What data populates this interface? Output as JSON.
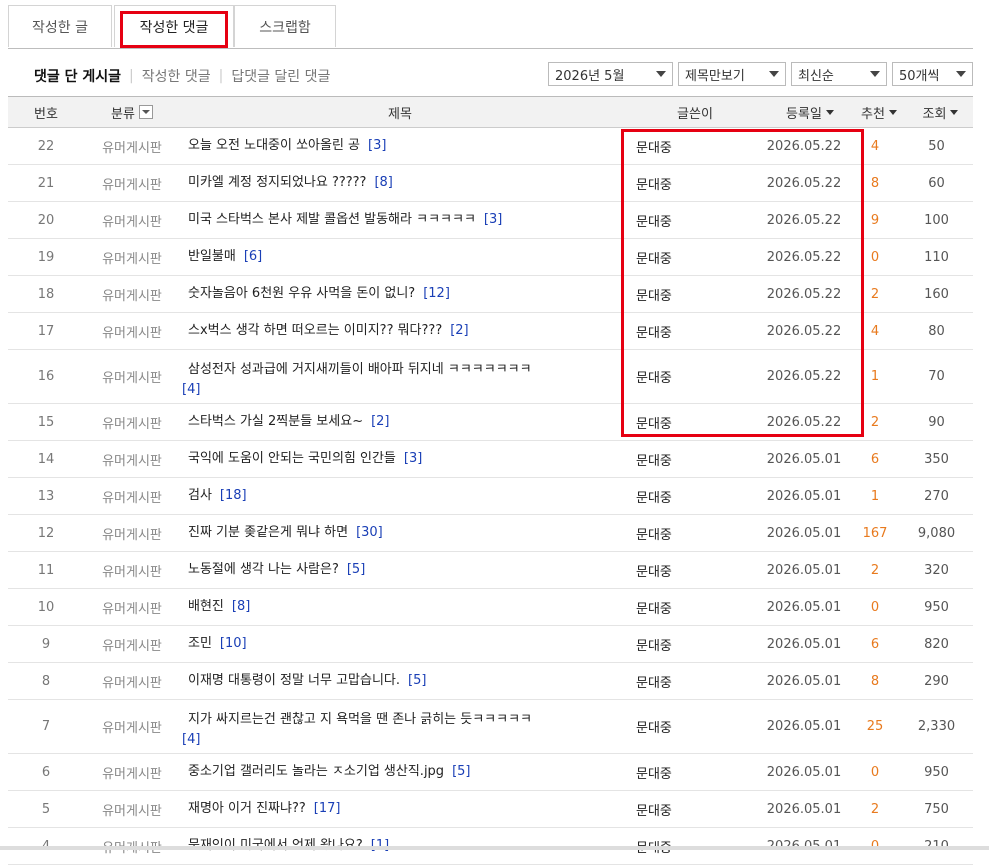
{
  "tabs": [
    {
      "label": "작성한 글",
      "active": false
    },
    {
      "label": "작성한 댓글",
      "active": true
    },
    {
      "label": "스크랩함",
      "active": false
    }
  ],
  "subnav": [
    {
      "label": "댓글 단 게시글",
      "active": true
    },
    {
      "label": "작성한 댓글",
      "active": false
    },
    {
      "label": "답댓글 달린 댓글",
      "active": false
    }
  ],
  "filters": {
    "month": "2026년 5월",
    "view_mode": "제목만보기",
    "sort": "최신순",
    "per_page": "50개씩"
  },
  "columns": {
    "no": "번호",
    "category": "분류",
    "title": "제목",
    "author": "글쓴이",
    "date": "등록일",
    "recommend": "추천",
    "views": "조회"
  },
  "rows": [
    {
      "no": "22",
      "category": "유머게시판",
      "title": "오늘 오전 노대중이 쏘아올린 공",
      "comments": "[3]",
      "author": "문대중",
      "date": "2026.05.22",
      "recommend": "4",
      "views": "50"
    },
    {
      "no": "21",
      "category": "유머게시판",
      "title": "미카엘 계정 정지되었나요 ?????",
      "comments": "[8]",
      "author": "문대중",
      "date": "2026.05.22",
      "recommend": "8",
      "views": "60"
    },
    {
      "no": "20",
      "category": "유머게시판",
      "title": "미국 스타벅스 본사 제발 콜옵션 발동해라 ㅋㅋㅋㅋㅋ",
      "comments": "[3]",
      "author": "문대중",
      "date": "2026.05.22",
      "recommend": "9",
      "views": "100"
    },
    {
      "no": "19",
      "category": "유머게시판",
      "title": "반일불매",
      "comments": "[6]",
      "author": "문대중",
      "date": "2026.05.22",
      "recommend": "0",
      "views": "110"
    },
    {
      "no": "18",
      "category": "유머게시판",
      "title": "숫자놀음아 6천원 우유 사먹을 돈이 없니?",
      "comments": "[12]",
      "author": "문대중",
      "date": "2026.05.22",
      "recommend": "2",
      "views": "160"
    },
    {
      "no": "17",
      "category": "유머게시판",
      "title": "스x벅스 생각 하면 떠오르는 이미지?? 뭐다???",
      "comments": "[2]",
      "author": "문대중",
      "date": "2026.05.22",
      "recommend": "4",
      "views": "80"
    },
    {
      "no": "16",
      "category": "유머게시판",
      "title": "삼성전자 성과급에 거지새끼들이 배아파 뒤지네 ㅋㅋㅋㅋㅋㅋㅋ",
      "comments": "[4]",
      "author": "문대중",
      "date": "2026.05.22",
      "recommend": "1",
      "views": "70",
      "wrap": true
    },
    {
      "no": "15",
      "category": "유머게시판",
      "title": "스타벅스 가실 2찍분들 보세요~",
      "comments": "[2]",
      "author": "문대중",
      "date": "2026.05.22",
      "recommend": "2",
      "views": "90"
    },
    {
      "no": "14",
      "category": "유머게시판",
      "title": "국익에 도움이 안되는 국민의힘 인간들",
      "comments": "[3]",
      "author": "문대중",
      "date": "2026.05.01",
      "recommend": "6",
      "views": "350"
    },
    {
      "no": "13",
      "category": "유머게시판",
      "title": "검사",
      "comments": "[18]",
      "author": "문대중",
      "date": "2026.05.01",
      "recommend": "1",
      "views": "270"
    },
    {
      "no": "12",
      "category": "유머게시판",
      "title": "진짜 기분 좆같은게 뭐냐 하면",
      "comments": "[30]",
      "author": "문대중",
      "date": "2026.05.01",
      "recommend": "167",
      "views": "9,080"
    },
    {
      "no": "11",
      "category": "유머게시판",
      "title": "노동절에 생각 나는 사람은?",
      "comments": "[5]",
      "author": "문대중",
      "date": "2026.05.01",
      "recommend": "2",
      "views": "320"
    },
    {
      "no": "10",
      "category": "유머게시판",
      "title": "배현진",
      "comments": "[8]",
      "author": "문대중",
      "date": "2026.05.01",
      "recommend": "0",
      "views": "950"
    },
    {
      "no": "9",
      "category": "유머게시판",
      "title": "조민",
      "comments": "[10]",
      "author": "문대중",
      "date": "2026.05.01",
      "recommend": "6",
      "views": "820"
    },
    {
      "no": "8",
      "category": "유머게시판",
      "title": "이재명 대통령이 정말 너무 고맙습니다.",
      "comments": "[5]",
      "author": "문대중",
      "date": "2026.05.01",
      "recommend": "8",
      "views": "290"
    },
    {
      "no": "7",
      "category": "유머게시판",
      "title": "지가 싸지르는건 괜찮고 지 욕먹을 땐 존나 긁히는 듯ㅋㅋㅋㅋㅋ",
      "comments": "[4]",
      "author": "문대중",
      "date": "2026.05.01",
      "recommend": "25",
      "views": "2,330",
      "wrap": true
    },
    {
      "no": "6",
      "category": "유머게시판",
      "title": "중소기업 갤러리도 놀라는 ㅈ소기업 생산직.jpg",
      "comments": "[5]",
      "author": "문대중",
      "date": "2026.05.01",
      "recommend": "0",
      "views": "950"
    },
    {
      "no": "5",
      "category": "유머게시판",
      "title": "재명아 이거 진짜냐??",
      "comments": "[17]",
      "author": "문대중",
      "date": "2026.05.01",
      "recommend": "2",
      "views": "750"
    },
    {
      "no": "4",
      "category": "유머게시판",
      "title": "문재인이 미국에서 언제 왔나요?",
      "comments": "[1]",
      "author": "문대중",
      "date": "2026.05.01",
      "recommend": "0",
      "views": "210"
    }
  ],
  "colors": {
    "highlight": "#e60012",
    "comment_count": "#1a3fb6",
    "recommend": "#e87a1e"
  }
}
